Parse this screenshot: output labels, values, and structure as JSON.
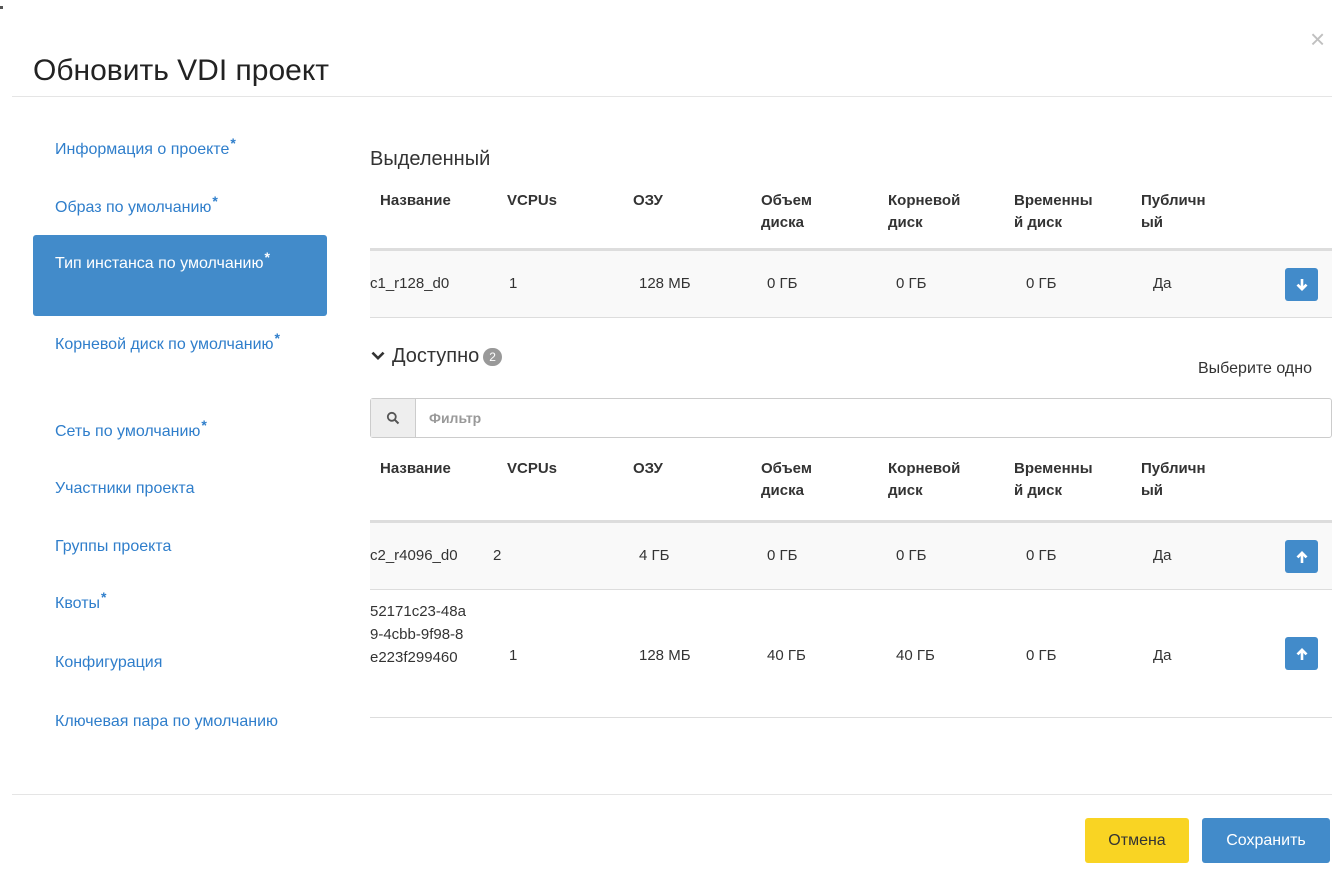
{
  "modal": {
    "title": "Обновить VDI проект",
    "close_glyph": "×"
  },
  "sidebar": {
    "items": [
      {
        "label": "Информация о проекте",
        "required": true,
        "active": false
      },
      {
        "label": "Образ по умолчанию",
        "required": true,
        "active": false
      },
      {
        "label": "Тип инстанса по умолчанию",
        "required": true,
        "active": true
      },
      {
        "label": "Корневой диск по умолчанию",
        "required": true,
        "active": false
      },
      {
        "label": "Сеть по умолчанию",
        "required": true,
        "active": false
      },
      {
        "label": "Участники проекта",
        "required": false,
        "active": false
      },
      {
        "label": "Группы проекта",
        "required": false,
        "active": false
      },
      {
        "label": "Квоты",
        "required": true,
        "active": false
      },
      {
        "label": "Конфигурация",
        "required": false,
        "active": false
      },
      {
        "label": "Ключевая пара по умолчанию",
        "required": false,
        "active": false
      }
    ],
    "required_mark": "*"
  },
  "table_headers": {
    "name": "Название",
    "vcpus": "VCPUs",
    "ram": "ОЗУ",
    "disk": "Объем диска",
    "root_disk": "Корневой диск",
    "ephemeral": "Временный диск",
    "public": "Публичный"
  },
  "allocated": {
    "heading": "Выделенный",
    "rows": [
      {
        "name": "c1_r128_d0",
        "vcpus": "1",
        "ram": "128 МБ",
        "disk": "0 ГБ",
        "root_disk": "0 ГБ",
        "ephemeral": "0 ГБ",
        "public": "Да"
      }
    ]
  },
  "available": {
    "heading": "Доступно",
    "count": "2",
    "hint": "Выберите одно",
    "filter_placeholder": "Фильтр",
    "rows": [
      {
        "name": "c2_r4096_d0",
        "vcpus": "2",
        "ram": "4 ГБ",
        "disk": "0 ГБ",
        "root_disk": "0 ГБ",
        "ephemeral": "0 ГБ",
        "public": "Да"
      },
      {
        "name": "52171c23-48a9-4cbb-9f98-8e223f299460",
        "vcpus": "1",
        "ram": "128 МБ",
        "disk": "40 ГБ",
        "root_disk": "40 ГБ",
        "ephemeral": "0 ГБ",
        "public": "Да"
      }
    ]
  },
  "footer": {
    "cancel_label": "Отмена",
    "save_label": "Сохранить"
  },
  "icons": {
    "close": "close-icon",
    "chevron": "chevron-down-icon",
    "search": "search-icon",
    "deallocate": "arrow-down-icon",
    "allocate": "arrow-up-icon"
  },
  "colors": {
    "primary": "#428bca",
    "link": "#2f7ecb",
    "warning": "#f9d423",
    "badge": "#999999"
  }
}
